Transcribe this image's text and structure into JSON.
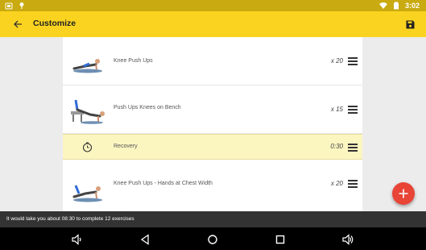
{
  "status_bar": {
    "time": "3:02",
    "left_icons": [
      "android-icon",
      "location-pin-icon"
    ],
    "right_icons": [
      "wifi-icon",
      "battery-icon"
    ]
  },
  "app_bar": {
    "title": "Customize",
    "back_icon": "arrow-back-icon",
    "save_icon": "save-floppy-icon",
    "color": "#f9d31f"
  },
  "exercise_list": {
    "items": [
      {
        "type": "exercise",
        "name": "Knee Push Ups",
        "count": "x 20",
        "thumbnail": "knee-push-ups-figure"
      },
      {
        "type": "exercise",
        "name": "Push Ups Knees on Bench",
        "count": "x 15",
        "thumbnail": "bench-push-ups-figure"
      },
      {
        "type": "recovery",
        "name": "Recovery",
        "count": "0:30",
        "icon": "timer-icon"
      },
      {
        "type": "exercise",
        "name": "Knee Push Ups - Hands at Chest Width",
        "count": "x 20",
        "thumbnail": "chest-width-push-ups-figure"
      }
    ]
  },
  "fab": {
    "icon": "plus-icon",
    "color": "#e84537"
  },
  "snackbar": {
    "message": "It would take you about 08:30 to complete 12 exercises"
  },
  "nav_bar": {
    "buttons": [
      "volume-down-icon",
      "back-triangle-icon",
      "home-circle-icon",
      "recents-square-icon",
      "volume-up-icon"
    ]
  }
}
